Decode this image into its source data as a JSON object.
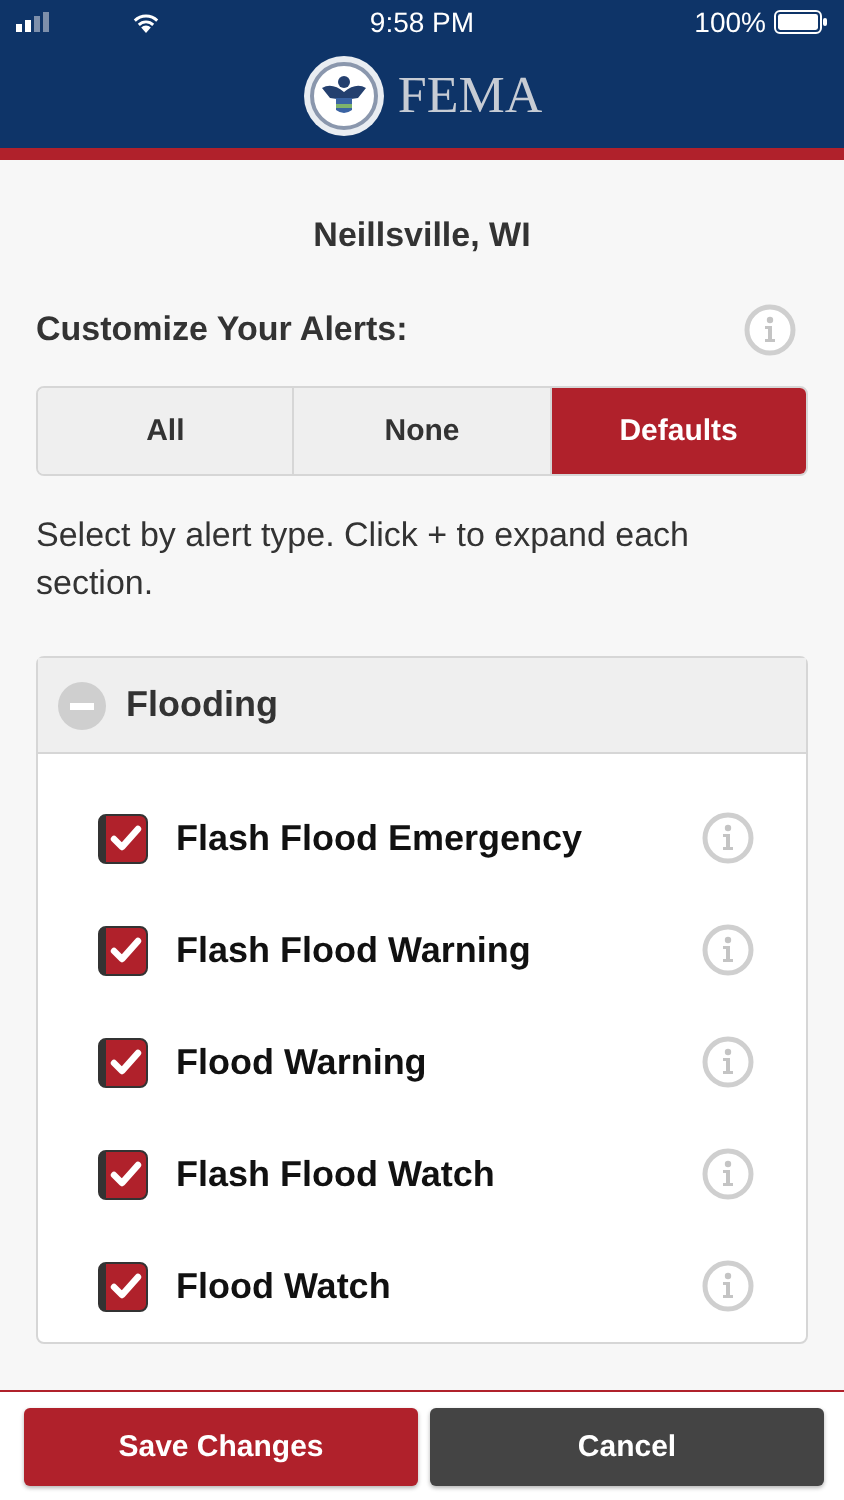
{
  "status_bar": {
    "time": "9:58 PM",
    "battery": "100%"
  },
  "header": {
    "logo_text": "FEMA"
  },
  "location": "Neillsville, WI",
  "section_title": "Customize Your Alerts:",
  "segments": [
    {
      "label": "All",
      "selected": false
    },
    {
      "label": "None",
      "selected": false
    },
    {
      "label": "Defaults",
      "selected": true
    }
  ],
  "instructions": "Select by alert type. Click + to expand each section.",
  "group": {
    "title": "Flooding",
    "expanded": true,
    "items": [
      {
        "label": "Flash Flood Emergency",
        "checked": true
      },
      {
        "label": "Flash Flood Warning",
        "checked": true
      },
      {
        "label": "Flood Warning",
        "checked": true
      },
      {
        "label": "Flash Flood Watch",
        "checked": true
      },
      {
        "label": "Flood Watch",
        "checked": true
      }
    ]
  },
  "buttons": [
    {
      "label": "Save Changes",
      "kind": "primary"
    },
    {
      "label": "Cancel",
      "kind": "secondary"
    }
  ]
}
